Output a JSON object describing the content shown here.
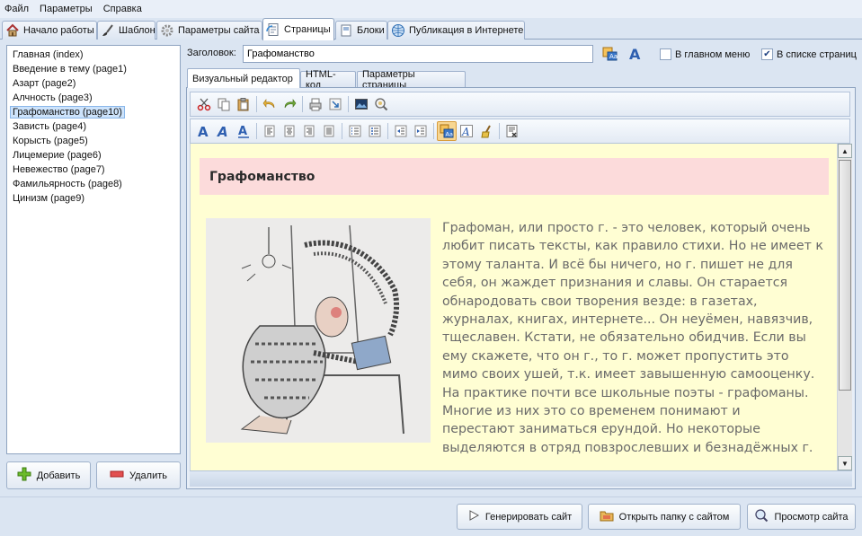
{
  "menu": [
    "Файл",
    "Параметры",
    "Справка"
  ],
  "tabs": [
    {
      "label": "Начало работы",
      "icon": "home-icon"
    },
    {
      "label": "Шаблон",
      "icon": "brush-icon"
    },
    {
      "label": "Параметры сайта",
      "icon": "gear-icon"
    },
    {
      "label": "Страницы",
      "icon": "page-icon",
      "active": true
    },
    {
      "label": "Блоки",
      "icon": "block-icon"
    },
    {
      "label": "Публикация в Интернете",
      "icon": "globe-icon"
    }
  ],
  "pages": [
    "Главная (index)",
    "Введение в тему (page1)",
    "Азарт (page2)",
    "Алчность (page3)",
    "Графоманство (page10)",
    "Зависть (page4)",
    "Корысть (page5)",
    "Лицемерие (page6)",
    "Невежество (page7)",
    "Фамильярность (page8)",
    "Цинизм (page9)"
  ],
  "selected_page": "Графоманство (page10)",
  "left_buttons": {
    "add": "Добавить",
    "delete": "Удалить"
  },
  "header": {
    "title_label": "Заголовок:",
    "title_value": "Графоманство",
    "in_main_menu": "В главном меню",
    "in_main_menu_checked": false,
    "in_page_list": "В списке страниц",
    "in_page_list_checked": true
  },
  "editor_tabs": [
    "Визуальный редактор",
    "HTML-код",
    "Параметры страницы"
  ],
  "content": {
    "heading": "Графоманство",
    "text_lines": [
      "Графоман, или просто г. - это человек, который очень",
      "любит писать тексты, как правило стихи. Но не имеет к",
      "этому таланта. И всё бы ничего, но г. пишет не для",
      "себя, он жаждет признания и славы. Он старается",
      "обнародовать свои творения везде: в газетах,",
      "журналах, книгах, интернете... Он неуёмен, навязчив,",
      "тщеславен. Кстати, не обязательно обидчив. Если вы",
      "ему скажете, что он г., то г. может пропустить это",
      "мимо своих ушей, т.к. имеет завышенную самооценку.",
      "На практике почти все школьные поэты - графоманы.",
      "Многие из них это со временем понимают и",
      "перестают заниматься ерундой. Но некоторые",
      "выделяются в отряд повзрослевших и безнадёжных г."
    ]
  },
  "bottom_buttons": {
    "generate": "Генерировать сайт",
    "open_folder": "Открыть папку с сайтом",
    "preview": "Просмотр сайта"
  },
  "colors": {
    "heading_bg": "#fcdbdb",
    "content_bg": "#fffed3",
    "selection": "#cde3fb"
  }
}
